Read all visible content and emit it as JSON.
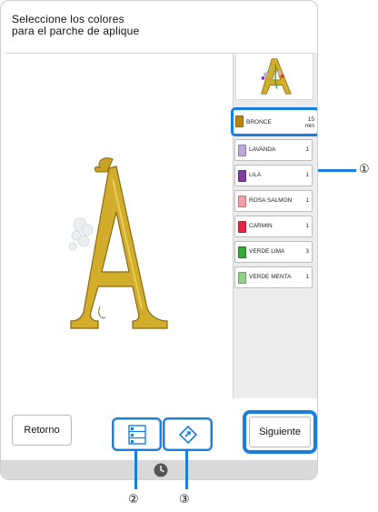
{
  "title": "Seleccione los colores\npara el parche de aplique",
  "threads": [
    {
      "name": "BRONCE",
      "count": "15\nmin",
      "color": "#b8860b",
      "selected": true
    },
    {
      "name": "LAVANDA",
      "count": "1",
      "color": "#b9a9d6"
    },
    {
      "name": "LILA",
      "count": "1",
      "color": "#7d3f9a"
    },
    {
      "name": "ROSA SALMON",
      "count": "1",
      "color": "#f2a0a8"
    },
    {
      "name": "CARMIN",
      "count": "1",
      "color": "#e0284a"
    },
    {
      "name": "VERDE LIMA",
      "count": "3",
      "color": "#3aa53a"
    },
    {
      "name": "VERDE MENTA",
      "count": "1",
      "color": "#8fd08a"
    }
  ],
  "buttons": {
    "back": "Retorno",
    "next": "Siguiente"
  },
  "icons": {
    "list": "thread-list-icon",
    "move": "move-pattern-icon",
    "clock": "clock-icon"
  },
  "callouts": [
    "①",
    "②",
    "③"
  ],
  "accent": "#1a7ee0"
}
